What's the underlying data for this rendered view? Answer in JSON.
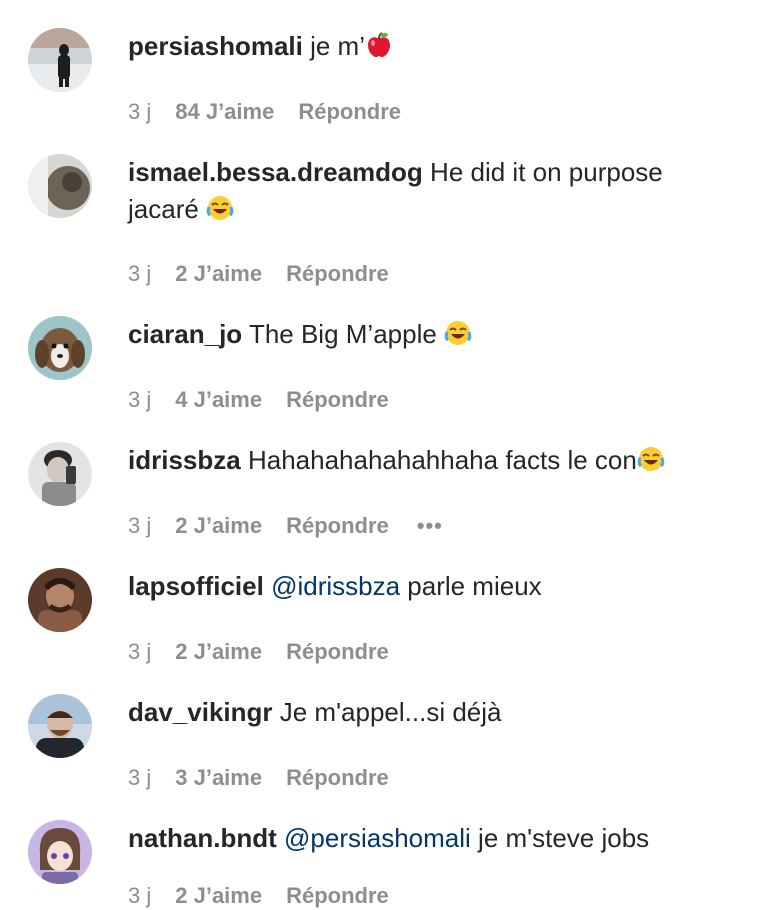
{
  "comments": [
    {
      "username": "persiashomali",
      "text": "je m’",
      "emoji": "apple",
      "time": "3 j",
      "likes": "84 J’aime",
      "reply": "Répondre",
      "avatar_color": "#8b8f96"
    },
    {
      "username": "ismael.bessa.dreamdog",
      "text": "He did it on purpose jacaré",
      "emoji": "joy",
      "time": "3 j",
      "likes": "2 J’aime",
      "reply": "Répondre",
      "avatar_color": "#6e6357"
    },
    {
      "username": "ciaran_jo",
      "text": "The Big M’apple",
      "emoji": "joy",
      "time": "3 j",
      "likes": "4 J’aime",
      "reply": "Répondre",
      "avatar_color": "#7b5a3d"
    },
    {
      "username": "idrissbza",
      "text": "Hahahahahahahhaha facts le con",
      "emoji": "joy",
      "time": "3 j",
      "likes": "2 J’aime",
      "reply": "Répondre",
      "more": "•••",
      "avatar_color": "#c9c9c9"
    },
    {
      "username": "lapsofficiel",
      "mention": "@idrissbza",
      "text": " parle mieux",
      "time": "3 j",
      "likes": "2 J’aime",
      "reply": "Répondre",
      "avatar_color": "#8a5b45"
    },
    {
      "username": "dav_vikingr",
      "text": "Je m'appel...si déjà",
      "time": "3 j",
      "likes": "3 J’aime",
      "reply": "Répondre",
      "avatar_color": "#3a3f4a"
    },
    {
      "username": "nathan.bndt",
      "mention": "@persiashomali",
      "text": " je m'steve jobs",
      "time": "3 j",
      "likes": "2 J’aime",
      "reply": "Répondre",
      "avatar_color": "#b7a2d6"
    }
  ],
  "colors": {
    "text": "#262626",
    "meta": "#8e8e8e",
    "mention": "#00376b"
  }
}
